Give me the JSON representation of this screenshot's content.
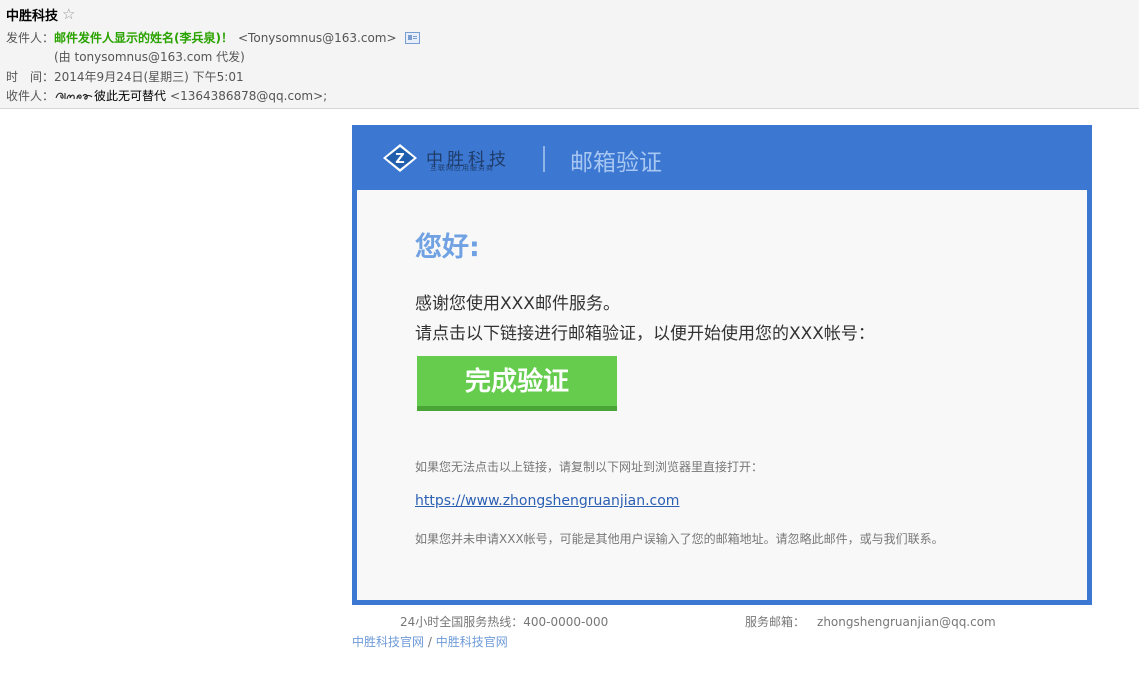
{
  "mail": {
    "subject": "中胜科技",
    "star_icon": "☆",
    "from_label": "发件人：",
    "from_name": "邮件发件人显示的姓名(李兵泉)！",
    "from_addr": "<Tonysomnus@163.com>",
    "via": "(由 tonysomnus@163.com 代发)",
    "time_label": "时　间：",
    "time_value": "2014年9月24日(星期三) 下午5:01",
    "to_label": "收件人：",
    "to_name": "彼此无可替代",
    "to_addr": "<1364386878@qq.com>;"
  },
  "header": {
    "logo_text": "中胜科技",
    "logo_sub": "互联网应用服务商",
    "title": "邮箱验证",
    "brand_color": "#3c78d1"
  },
  "body": {
    "greeting": "您好:",
    "line1": "感谢您使用XXX邮件服务。",
    "line2": "请点击以下链接进行邮箱验证，以便开始使用您的XXX帐号：",
    "button_label": "完成验证",
    "hint1": "如果您无法点击以上链接，请复制以下网址到浏览器里直接打开：",
    "link": "https://www.zhongshengruanjian.com",
    "hint2": "如果您并未申请XXX帐号，可能是其他用户误输入了您的邮箱地址。请忽略此邮件，或与我们联系。",
    "button_color": "#66cc4d"
  },
  "footer": {
    "hotline": "24小时全国服务热线：400-0000-000",
    "email_label": "服务邮箱：",
    "email_value": "zhongshengruanjian@qq.com",
    "link1": "中胜科技官网",
    "separator": " / ",
    "link2": "中胜科技官网"
  }
}
